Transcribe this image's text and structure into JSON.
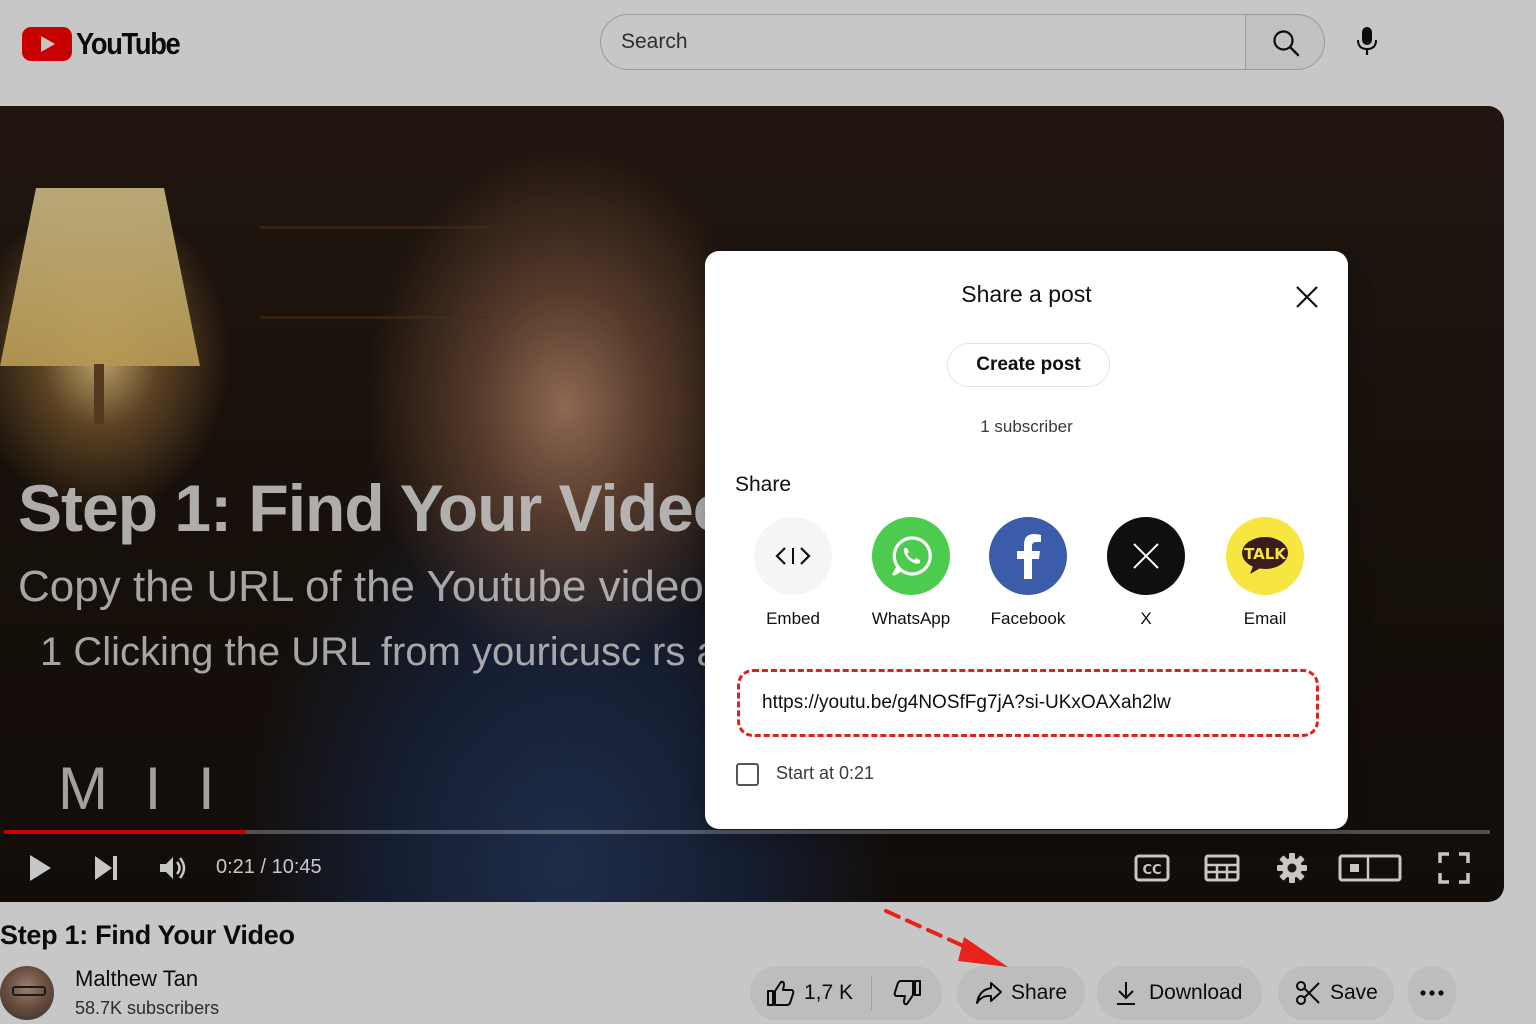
{
  "header": {
    "logo_text": "YouTube",
    "search_placeholder": "Search"
  },
  "player": {
    "overlay_title": "Step 1: Find Your Video",
    "overlay_subtitle": "Copy the URL of the Youtube video",
    "overlay_step": "1  Clicking the URL from youricusc rs ac",
    "overlay_mark": "M I I",
    "time": "0:21 / 10:45",
    "progress": 0.162
  },
  "video": {
    "title": "Step 1: Find Your Video",
    "channel_name": "Malthew Tan",
    "channel_subscribers": "58.7K subscribers"
  },
  "actions": {
    "like_count": "1,7 K",
    "share_label": "Share",
    "download_label": "Download",
    "save_label": "Save"
  },
  "dialog": {
    "title": "Share a post",
    "create_post_label": "Create post",
    "subscriber_count": "1 subscriber",
    "share_heading": "Share",
    "targets": [
      {
        "label": "Embed",
        "color": "#f5f5f5"
      },
      {
        "label": "WhatsApp",
        "color": "#4ccb4f"
      },
      {
        "label": "Facebook",
        "color": "#3b5ca8"
      },
      {
        "label": "X",
        "color": "#0f0f0f"
      },
      {
        "label": "Email",
        "color": "#f7e540"
      }
    ],
    "kakao_badge": "TALK",
    "url": "https://youtu.be/g4NOSfFg7jA?si-UKxOAXah2lw",
    "start_at_label": "Start at 0:21"
  },
  "colors": {
    "brand_red": "#ff0000",
    "highlight_red": "#e0201b"
  }
}
